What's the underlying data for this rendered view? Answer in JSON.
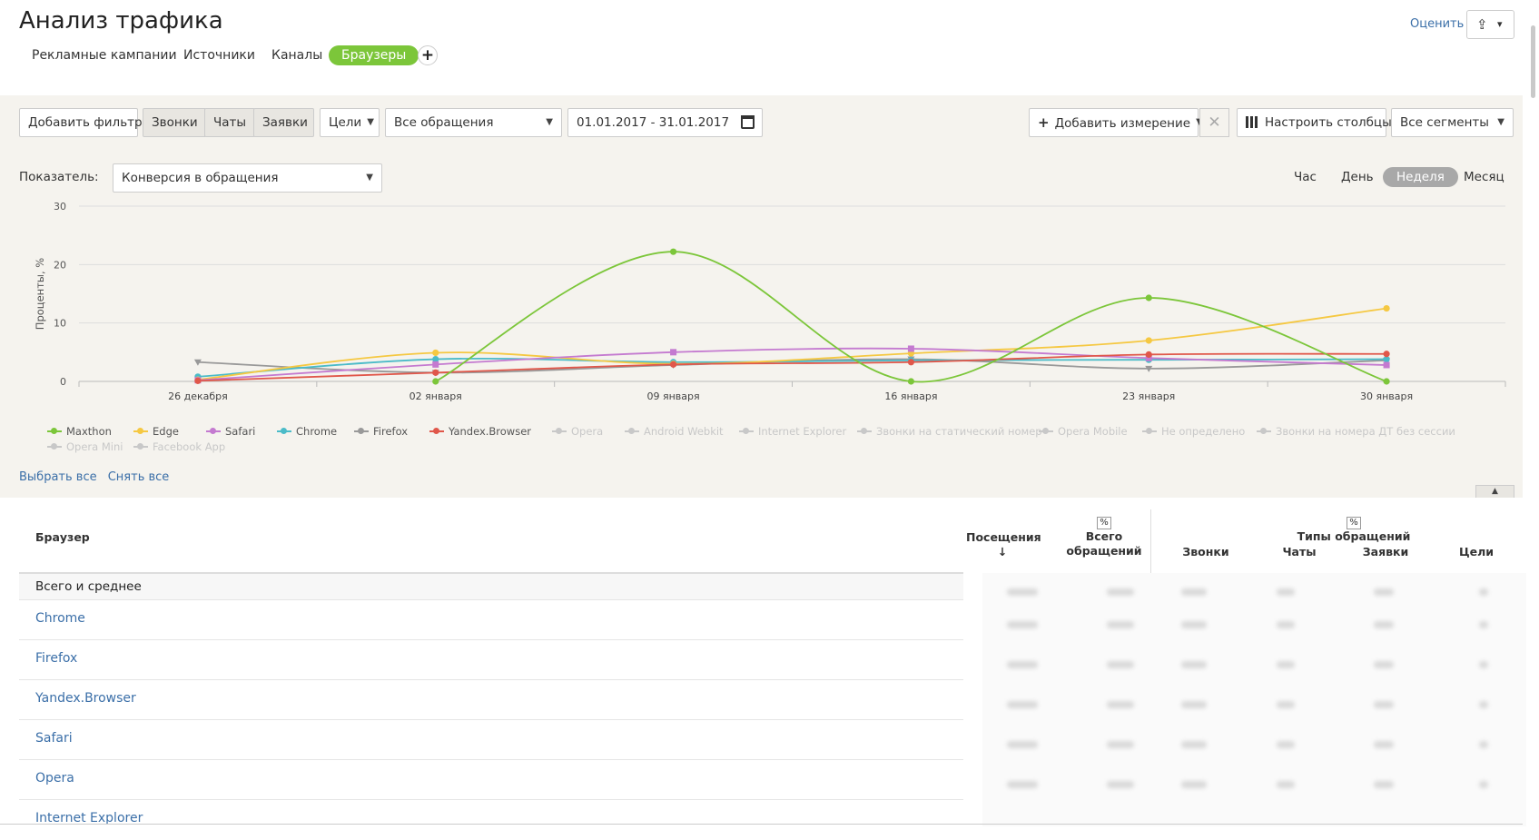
{
  "header": {
    "title": "Анализ трафика",
    "rate_link": "Оценить",
    "share_icon": "share-icon",
    "tabs": [
      {
        "label": "Рекламные кампании",
        "active": false
      },
      {
        "label": "Источники",
        "active": false
      },
      {
        "label": "Каналы",
        "active": false
      },
      {
        "label": "Браузеры",
        "active": true
      }
    ]
  },
  "filters": {
    "add_filter": "Добавить фильтр",
    "segments": [
      "Звонки",
      "Чаты",
      "Заявки"
    ],
    "goals": "Цели",
    "requests": "Все обращения",
    "date_range": "01.01.2017 - 31.01.2017",
    "add_dimension": "Добавить измерение",
    "clear": "✕",
    "columns": "Настроить столбцы",
    "all_segments": "Все сегменты"
  },
  "metric": {
    "label": "Показатель:",
    "value": "Конверсия в обращения"
  },
  "periods": [
    {
      "label": "Час",
      "active": false
    },
    {
      "label": "День",
      "active": false
    },
    {
      "label": "Неделя",
      "active": true
    },
    {
      "label": "Месяц",
      "active": false
    }
  ],
  "chart_data": {
    "type": "line",
    "ylabel": "Проценты, %",
    "ylim": [
      0,
      30
    ],
    "yticks": [
      0,
      10,
      20,
      30
    ],
    "categories": [
      "26 декабря",
      "02 января",
      "09 января",
      "16 января",
      "23 января",
      "30 января"
    ],
    "grid": true,
    "legend_position": "bottom",
    "series": [
      {
        "name": "Maxthon",
        "color": "#7cc63a",
        "values": [
          null,
          0,
          22.2,
          0,
          14.3,
          0
        ]
      },
      {
        "name": "Edge",
        "color": "#f5c842",
        "values": [
          0.3,
          4.9,
          3.0,
          4.8,
          7.0,
          12.5
        ]
      },
      {
        "name": "Safari",
        "color": "#c47ad0",
        "values": [
          0.2,
          2.9,
          5.0,
          5.6,
          4.0,
          2.8
        ]
      },
      {
        "name": "Chrome",
        "color": "#4bbbc8",
        "values": [
          0.8,
          3.8,
          3.3,
          3.6,
          3.7,
          3.8
        ]
      },
      {
        "name": "Firefox",
        "color": "#999999",
        "values": [
          3.3,
          1.5,
          2.8,
          3.8,
          2.2,
          3.6
        ]
      },
      {
        "name": "Yandex.Browser",
        "color": "#e0574a",
        "values": [
          0.1,
          1.5,
          2.9,
          3.3,
          4.6,
          4.7
        ]
      }
    ],
    "hidden_series": [
      "Opera",
      "Android Webkit",
      "Internet Explorer",
      "Звонки на статический номер",
      "Opera Mobile",
      "Не определено",
      "Звонки на номера ДТ без сессии",
      "Opera Mini",
      "Facebook App"
    ]
  },
  "legend_links": {
    "select_all": "Выбрать все",
    "deselect_all": "Снять все"
  },
  "table": {
    "col_browser": "Браузер",
    "col_visits": "Посещения",
    "col_total_line1": "Всего",
    "col_total_line2": "обращений",
    "pct": "%",
    "col_types": "Типы обращений",
    "col_calls": "Звонки",
    "col_chats": "Чаты",
    "col_requests": "Заявки",
    "col_goals": "Цели",
    "total_row": "Всего и среднее",
    "rows": [
      "Chrome",
      "Firefox",
      "Yandex.Browser",
      "Safari",
      "Opera",
      "Internet Explorer"
    ]
  }
}
